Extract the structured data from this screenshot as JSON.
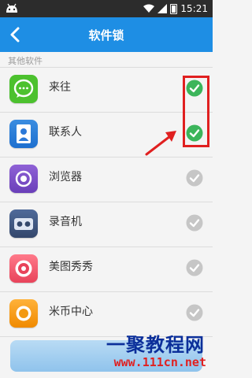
{
  "status_bar": {
    "time": "15:21"
  },
  "app_bar": {
    "title": "软件锁"
  },
  "section": {
    "title": "其他软件"
  },
  "apps": [
    {
      "name": "来往",
      "checked": true
    },
    {
      "name": "联系人",
      "checked": true
    },
    {
      "name": "浏览器",
      "checked": false
    },
    {
      "name": "录音机",
      "checked": false
    },
    {
      "name": "美图秀秀",
      "checked": false
    },
    {
      "name": "米币中心",
      "checked": false
    }
  ],
  "colors": {
    "primary": "#1e8ee4",
    "checked": "#3cb55b",
    "unchecked": "#c6c6c6",
    "highlight": "#e02020"
  },
  "watermark": {
    "title": "一聚教程网",
    "url": "www.111cn.net"
  }
}
